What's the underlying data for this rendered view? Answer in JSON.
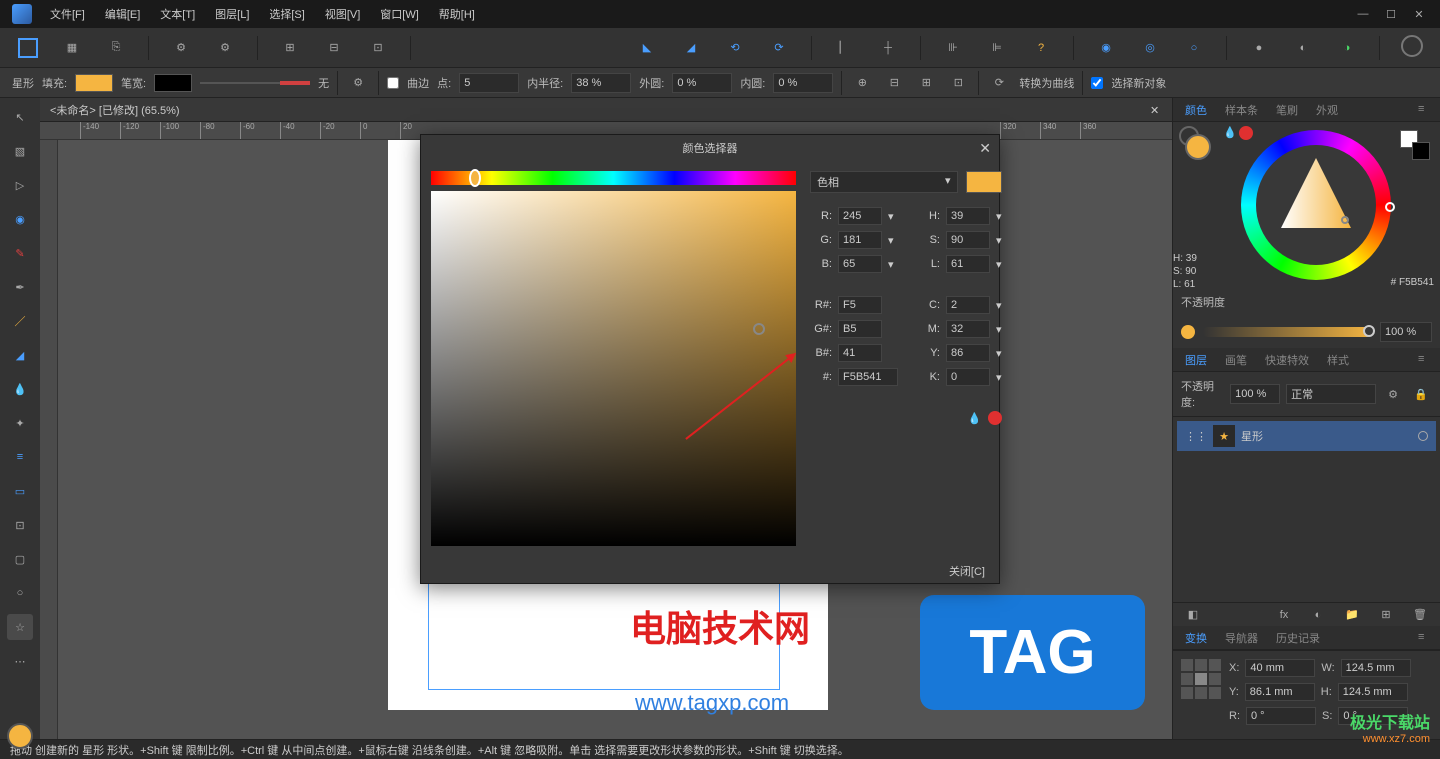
{
  "menu": {
    "file": "文件[F]",
    "edit": "编辑[E]",
    "text": "文本[T]",
    "layer": "图层[L]",
    "select": "选择[S]",
    "view": "视图[V]",
    "window": "窗口[W]",
    "help": "帮助[H]"
  },
  "optbar": {
    "shape": "星形",
    "fill": "填充:",
    "stroke": "笔宽:",
    "none": "无",
    "curve": "曲边",
    "points": "点:",
    "points_val": "5",
    "inner": "内半径:",
    "inner_val": "38 %",
    "outer": "外圆:",
    "outer_val": "0 %",
    "innerc": "内圆:",
    "innerc_val": "0 %",
    "convert": "转换为曲线",
    "selnew": "选择新对象"
  },
  "doc": {
    "title": "<未命名> [已修改] (65.5%)"
  },
  "colorpicker": {
    "title": "颜色选择器",
    "mode": "色相",
    "close": "关闭[C]",
    "R": "R:",
    "G": "G:",
    "B": "B:",
    "Rh": "R#:",
    "Gh": "G#:",
    "Bh": "B#:",
    "hex": "#:",
    "H": "H:",
    "S": "S:",
    "L": "L:",
    "C": "C:",
    "M": "M:",
    "Y": "Y:",
    "K": "K:",
    "r_val": "245",
    "g_val": "181",
    "b_val": "65",
    "rh_val": "F5",
    "gh_val": "B5",
    "bh_val": "41",
    "hex_val": "F5B541",
    "h_val": "39",
    "s_val": "90",
    "l_val": "61",
    "c_val": "2",
    "m_val": "32",
    "y_val": "86",
    "k_val": "0"
  },
  "panels": {
    "color": "颜色",
    "swatches": "样本条",
    "brushes": "笔刷",
    "appearance": "外观",
    "layers": "图层",
    "strokep": "画笔",
    "fx": "快速特效",
    "styles": "样式",
    "transform": "变换",
    "navigator": "导航器",
    "history": "历史记录",
    "opacity_lbl": "不透明度",
    "opacity_val": "100 %",
    "blend_lbl": "不透明度:",
    "blend_val": "100 %",
    "blend_mode": "正常",
    "hsl": "H: 39\nS: 90\nL: 61",
    "hex_disp": "# F5B541"
  },
  "layer": {
    "name": "星形"
  },
  "transform": {
    "X": "X:",
    "Y": "Y:",
    "W": "W:",
    "H": "H:",
    "R": "R:",
    "S": "S:",
    "x_val": "40 mm",
    "y_val": "86.1 mm",
    "w_val": "124.5 mm",
    "h_val": "124.5 mm",
    "r_val": "0 °",
    "s_val": "0 °"
  },
  "status": {
    "text": "拖动 创建新的 星形 形状。+Shift 键 限制比例。+Ctrl 键 从中间点创建。+鼠标右键 沿线条创建。+Alt 键 忽略吸附。单击 选择需要更改形状参数的形状。+Shift 键 切换选择。"
  },
  "watermarks": {
    "w1": "电脑技术网",
    "w2": "www.tagxp.com",
    "tag": "TAG",
    "logo1": "极光下载站",
    "logo2": "www.xz7.com"
  },
  "ruler": {
    "ticks": [
      "-140",
      "-120",
      "-100",
      "-80",
      "-60",
      "-40",
      "-20",
      "0",
      "20",
      "",
      "",
      "",
      "",
      "",
      "",
      "",
      "",
      "",
      "",
      "",
      "",
      "",
      "",
      "",
      "",
      "",
      "",
      "",
      "",
      "",
      "",
      "",
      "",
      "320",
      "340",
      "360"
    ]
  },
  "colors": {
    "accent": "#f5b541",
    "fill": "#f5b541",
    "stroke": "#000000"
  }
}
